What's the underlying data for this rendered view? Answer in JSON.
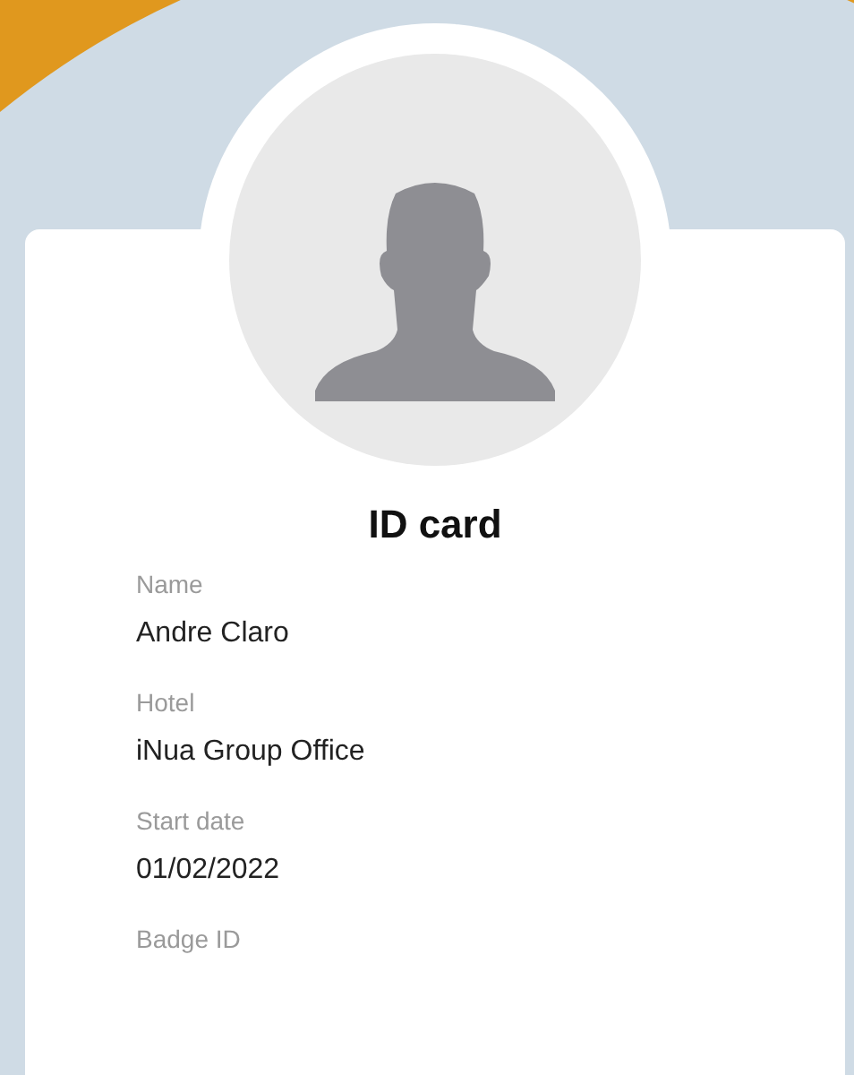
{
  "card": {
    "title": "ID card",
    "fields": [
      {
        "label": "Name",
        "value": "Andre Claro"
      },
      {
        "label": "Hotel",
        "value": "iNua Group Office"
      },
      {
        "label": "Start date",
        "value": "01/02/2022"
      },
      {
        "label": "Badge ID"
      }
    ]
  }
}
